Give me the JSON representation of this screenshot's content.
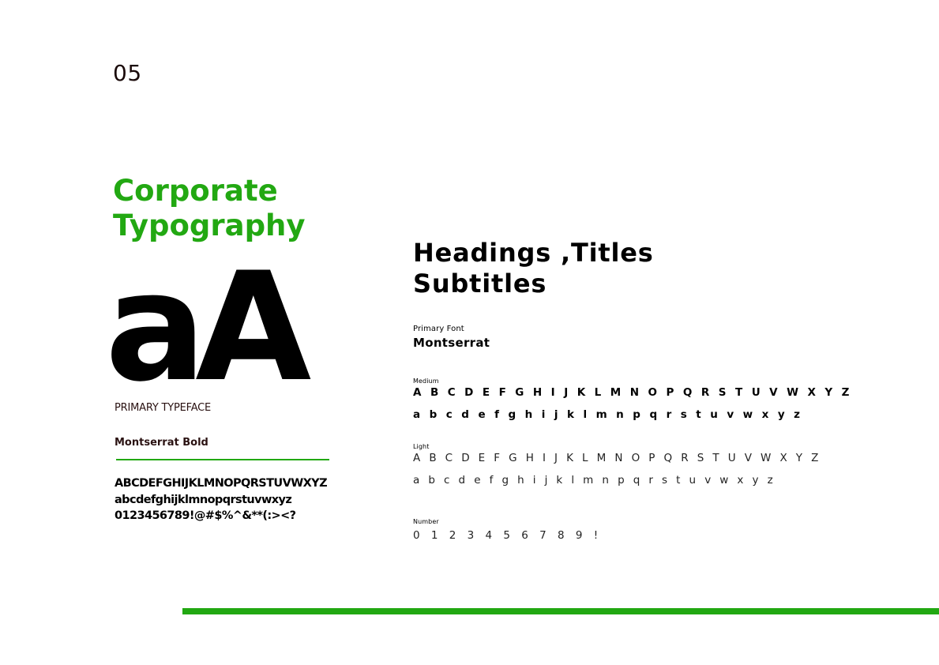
{
  "page": {
    "number": "05",
    "accent_color": "#22a812"
  },
  "left": {
    "title_line1": "Corporate",
    "title_line2": "Typography",
    "specimen": "aA",
    "typeface_label": "PRIMARY TYPEFACE",
    "typeface_name": "Montserrat Bold",
    "glyphs_upper": "ABCDEFGHIJKLMNOPQRSTUVWXYZ",
    "glyphs_lower": "abcdefghijklmnopqrstuvwxyz",
    "glyphs_symbols": "0123456789!@#$%^&**(:><?"
  },
  "right": {
    "heading_line1": "Headings ,Titles",
    "heading_line2": "Subtitles",
    "primary_font_label": "Primary Font",
    "primary_font_name": "Montserrat",
    "medium": {
      "label": "Medium",
      "upper": "A B C D E F G H I J K L M N O P Q R S T U V W X Y Z",
      "lower": "a b c d e f g h i j k l m n p q r s t u v w x y z"
    },
    "light": {
      "label": "Light",
      "upper": "A B C D E F G H I J K L M N O P Q R S T U V W X Y Z",
      "lower": "a b c d e f g h i j k l m n p q r s t u v w x y z"
    },
    "number": {
      "label": "Number",
      "row": "0 1 2 3 4 5 6 7 8 9 !"
    }
  }
}
